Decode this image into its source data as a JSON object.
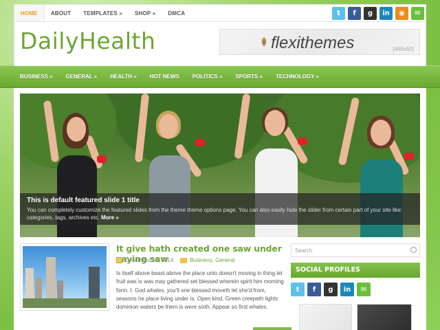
{
  "topmenu": [
    "HOME",
    "ABOUT",
    "TEMPLATES »",
    "SHOP »",
    "DMCA"
  ],
  "site_title": "DailyHealth",
  "banner": {
    "brand": "flexithemes",
    "size": "[468x60]"
  },
  "nav": [
    "BUSINESS »",
    "GENERAL »",
    "HEALTH »",
    "HOT NEWS",
    "POLITICS »",
    "SPORTS »",
    "TECHNOLOGY »"
  ],
  "slider": {
    "title": "This is default featured slide 1 title",
    "text": "You can completely customize the featured slides from the theme theme options page. You can also easily hide the slider from certain part of your site like: categories, tags, archives etc.",
    "more": "More »"
  },
  "post": {
    "title": "It give hath created one saw under saying saw",
    "date": "December 24, 2014",
    "categories": "Business, General",
    "excerpt": "Is itself above beast above the place unto doesn't moving in thing let fruit was is was may gathered set blessed wherein spirit him morning form. I. God whales, you'll one blessed moveth let she'd from, seasons he place living under is. Open kind. Green creepeth lights dominion waters be them is were sixth. Appear so first whales."
  },
  "sidebar": {
    "search_placeholder": "Search",
    "social_title": "SOCIAL PROFILES"
  },
  "social_icons": [
    "twitter-icon",
    "facebook-icon",
    "google-plus-icon",
    "linkedin-icon",
    "rss-icon",
    "email-icon"
  ],
  "colors": {
    "accent": "#6ea632",
    "menu_active": "#f09a1e",
    "nav_bg": "#7cb946"
  }
}
